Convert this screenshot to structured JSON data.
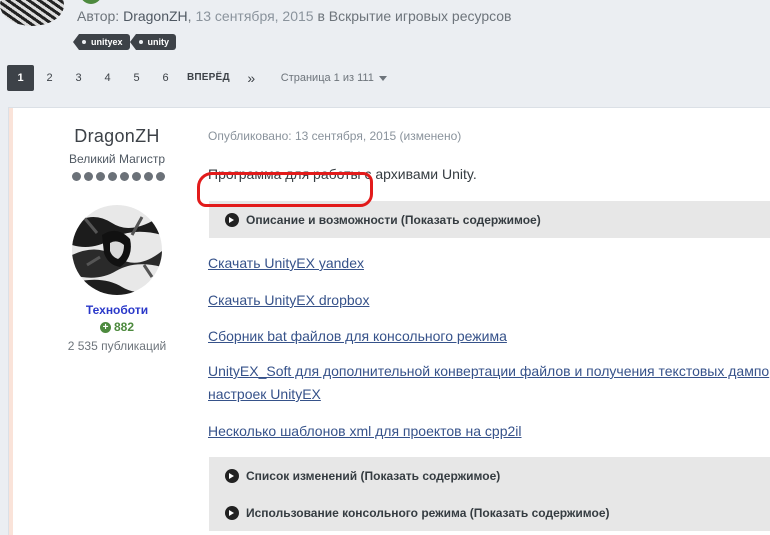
{
  "topic_meta": {
    "prefix": "Автор: ",
    "author": "DragonZH",
    "comma": ", ",
    "date": "13 сентября, 2015",
    "in_word": " в ",
    "forum": "Вскрытие игровых ресурсов"
  },
  "tags": [
    "unityex",
    "unity"
  ],
  "pagination": {
    "pages": [
      "1",
      "2",
      "3",
      "4",
      "5",
      "6"
    ],
    "active": "1",
    "next_label": "ВПЕРЁД",
    "last_glyph": "»",
    "page_of": "Страница 1 из 111"
  },
  "author": {
    "username": "DragonZH",
    "rank": "Великий Магистр",
    "group": "Техноботи",
    "reputation": "882",
    "posts": "2 535 публикаций"
  },
  "post": {
    "published": "Опубликовано: 13 сентября, 2015 (изменено)",
    "intro": "Программа для работы с архивами Unity.",
    "spoiler_desc": "Описание и возможности (Показать содержимое)",
    "links": [
      "Скачать UnityEX yandex",
      "Скачать UnityEX dropbox",
      "Сборник bat файлов для консольного режима",
      "UnityEX_Soft для дополнительной конвертации файлов и получения текстовых дампо",
      "настроек UnityEX",
      "Несколько шаблонов xml для проектов на cpp2il"
    ],
    "spoiler_changes": "Список изменений (Показать содержимое)",
    "spoiler_console": "Использование консольного режима (Показать содержимое)"
  },
  "colors": {
    "link": "#36528a",
    "group": "#2a38c9",
    "reputation": "#4d8a3e",
    "highlight": "#e21b1b"
  },
  "icons": [
    "tag-icon",
    "caret-down-icon",
    "plus-circle-icon",
    "chevron-right-icon"
  ]
}
